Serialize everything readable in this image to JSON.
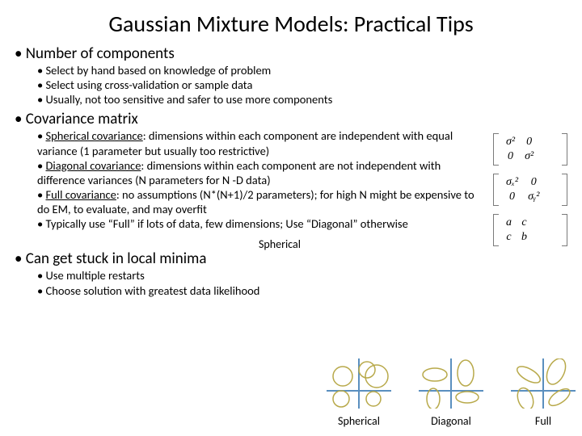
{
  "title": "Gaussian Mixture Models: Practical Tips",
  "s1": {
    "heading": "Number of components",
    "b1": "Select by hand based on knowledge of problem",
    "b2": "Select using cross-validation or sample data",
    "b3": "Usually, not too sensitive and safer to use more components"
  },
  "s2": {
    "heading": "Covariance matrix",
    "b1a": "Spherical covariance",
    "b1b": ": dimensions within each component are independent with equal variance (1 parameter but usually too restrictive)",
    "b2a": "Diagonal covariance",
    "b2b": ":  dimensions within each component are not independent with difference variances (N parameters for N -D data)",
    "b3a": "Full covariance",
    "b3b": ": no assumptions  (N*(N+1)/2 parameters); for high N might be expensive to do EM, to evaluate, and may overfit",
    "b4": "Typically use “Full” if lots of data, few dimensions; Use “Diagonal” otherwise",
    "float": "Spherical"
  },
  "s3": {
    "heading": "Can get stuck in local minima",
    "b1": "Use multiple restarts",
    "b2": "Choose solution with greatest data likelihood"
  },
  "mats": {
    "m1": {
      "a": "σ²",
      "b": "0",
      "c": "0",
      "d": "σ²"
    },
    "m2": {
      "a": "σₓ²",
      "b": "0",
      "c": "0",
      "d": "σᵧ²"
    },
    "m3": {
      "a": "a",
      "b": "c",
      "c": "c",
      "d": "b"
    }
  },
  "figlabels": {
    "a": "Spherical",
    "b": "Diagonal",
    "c": "Full"
  }
}
